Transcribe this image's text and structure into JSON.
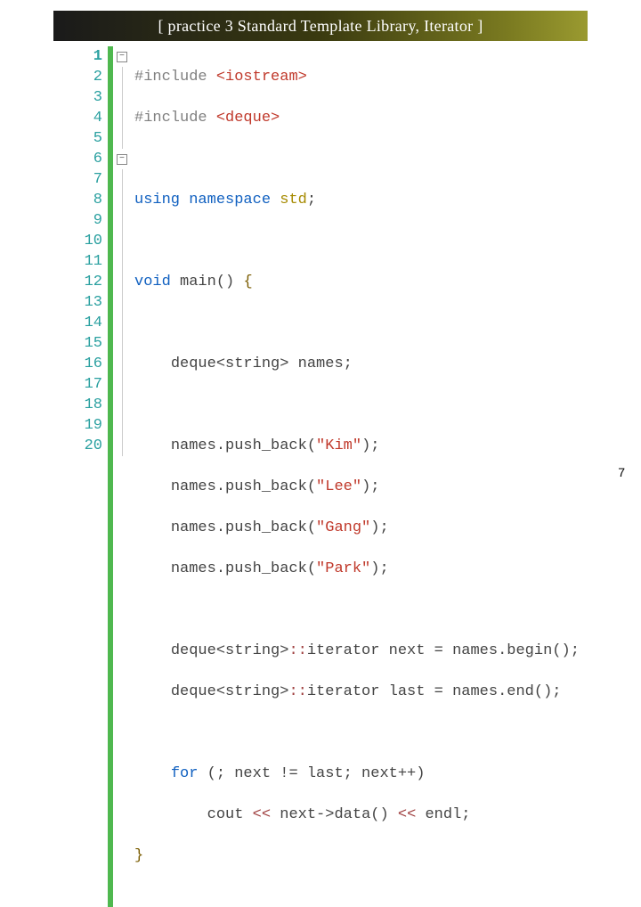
{
  "title": "[ practice 3 Standard Template Library, Iterator ]",
  "page_number": "7",
  "line_numbers": [
    "1",
    "2",
    "3",
    "4",
    "5",
    "6",
    "7",
    "8",
    "9",
    "10",
    "11",
    "12",
    "13",
    "14",
    "15",
    "16",
    "17",
    "18",
    "19",
    "20"
  ],
  "fold": {
    "box1_line": 1,
    "box2_line": 6,
    "symbol": "−"
  },
  "code": {
    "l1": {
      "pp": "#include ",
      "inc": "<iostream>"
    },
    "l2": {
      "pp": "#include ",
      "inc": "<deque>"
    },
    "l3": "",
    "l4": {
      "kw": "using ",
      "kw2": "namespace ",
      "ns": "std",
      "end": ";"
    },
    "l5": "",
    "l6": {
      "kw": "void ",
      "fn": "main() ",
      "br": "{"
    },
    "l7": "",
    "l8": {
      "ind": "    ",
      "txt": "deque<string> names;"
    },
    "l9": "",
    "l10": {
      "ind": "    ",
      "pre": "names.push_back(",
      "str": "\"Kim\"",
      "post": ");"
    },
    "l11": {
      "ind": "    ",
      "pre": "names.push_back(",
      "str": "\"Lee\"",
      "post": ");"
    },
    "l12": {
      "ind": "    ",
      "pre": "names.push_back(",
      "str": "\"Gang\"",
      "post": ");"
    },
    "l13": {
      "ind": "    ",
      "pre": "names.push_back(",
      "str": "\"Park\"",
      "post": ");"
    },
    "l14": "",
    "l15": {
      "ind": "    ",
      "a": "deque<string>",
      "scope": "::",
      "b": "iterator next = names.begin();"
    },
    "l16": {
      "ind": "    ",
      "a": "deque<string>",
      "scope": "::",
      "b": "iterator last = names.end();"
    },
    "l17": "",
    "l18": {
      "ind": "    ",
      "kw": "for ",
      "rest": "(; next != last; next++)"
    },
    "l19": {
      "ind": "        ",
      "a": "cout ",
      "op1": "<< ",
      "b": "next->data() ",
      "op2": "<< ",
      "c": "endl;"
    },
    "l20": {
      "br": "}"
    }
  }
}
